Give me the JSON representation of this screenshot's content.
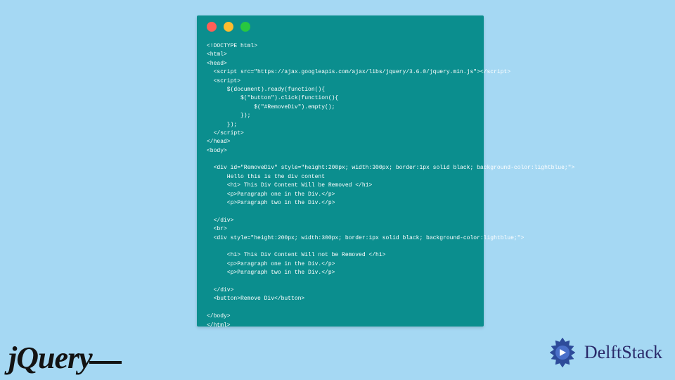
{
  "window": {
    "dots": {
      "red": "#ff5f57",
      "yellow": "#febc2e",
      "green": "#28c840"
    }
  },
  "code": {
    "lines": [
      "<!DOCTYPE html>",
      "<html>",
      "<head>",
      "  <script src=\"https://ajax.googleapis.com/ajax/libs/jquery/3.6.0/jquery.min.js\"></script>",
      "  <script>",
      "      $(document).ready(function(){",
      "          $(\"button\").click(function(){",
      "              $(\"#RemoveDiv\").empty();",
      "          });",
      "      });",
      "  </script>",
      "</head>",
      "<body>",
      "",
      "  <div id=\"RemoveDiv\" style=\"height:200px; width:300px; border:1px solid black; background-color:lightblue;\">",
      "      Hello this is the div content",
      "      <h1> This Div Content Will be Removed </h1>",
      "      <p>Paragraph one in the Div.</p>",
      "      <p>Paragraph two in the Div.</p>",
      "",
      "  </div>",
      "  <br>",
      "  <div style=\"height:200px; width:300px; border:1px solid black; background-color:lightblue;\">",
      "",
      "      <h1> This Div Content Will not be Removed </h1>",
      "      <p>Paragraph one in the Div.</p>",
      "      <p>Paragraph two in the Div.</p>",
      "",
      "  </div>",
      "  <button>Remove Div</button>",
      "",
      "</body>",
      "</html>"
    ]
  },
  "logos": {
    "jquery": "jQuery",
    "delft": "DelftStack"
  }
}
